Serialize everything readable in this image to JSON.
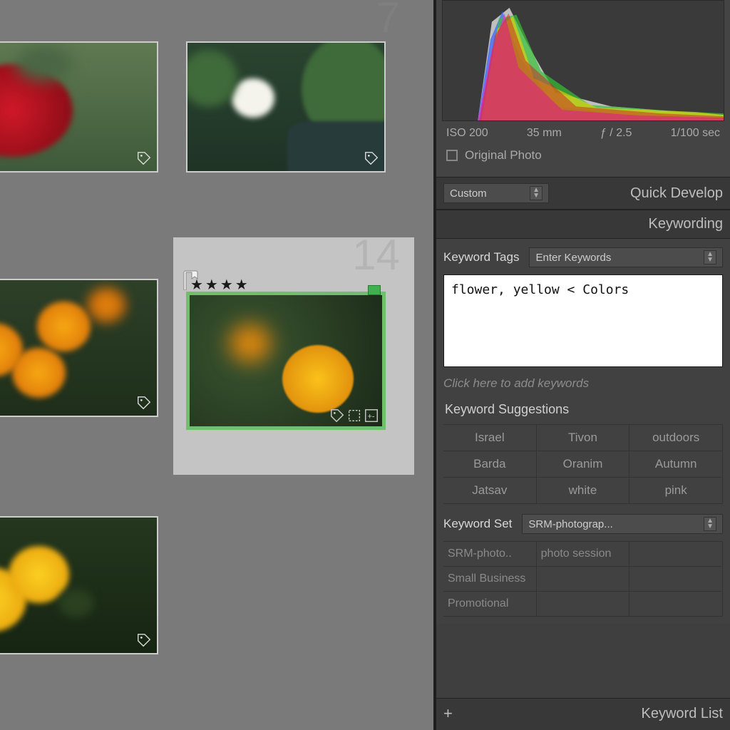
{
  "grid": {
    "index_top_right": "7",
    "index_selected": "14",
    "stars_selected": "★★★★"
  },
  "histogram": {
    "exif": {
      "iso": "ISO 200",
      "focal": "35 mm",
      "aperture": "ƒ / 2.5",
      "shutter": "1/100 sec"
    },
    "original_label": "Original Photo"
  },
  "quick_develop": {
    "preset": "Custom",
    "title": "Quick Develop"
  },
  "keywording": {
    "title": "Keywording",
    "tags_label": "Keyword Tags",
    "mode": "Enter Keywords",
    "value": "flower, yellow < Colors",
    "add_hint": "Click here to add keywords",
    "suggestions_label": "Keyword Suggestions",
    "suggestions": [
      "Israel",
      "Tivon",
      "outdoors",
      "Barda",
      "Oranim",
      "Autumn",
      "Jatsav",
      "white",
      "pink"
    ],
    "set_label": "Keyword Set",
    "set_value": "SRM-photograp...",
    "set_items": [
      "SRM-photo..",
      "photo session",
      "",
      "Small Business",
      "",
      "",
      "Promotional",
      "",
      ""
    ]
  },
  "keyword_list": {
    "title": "Keyword List"
  }
}
